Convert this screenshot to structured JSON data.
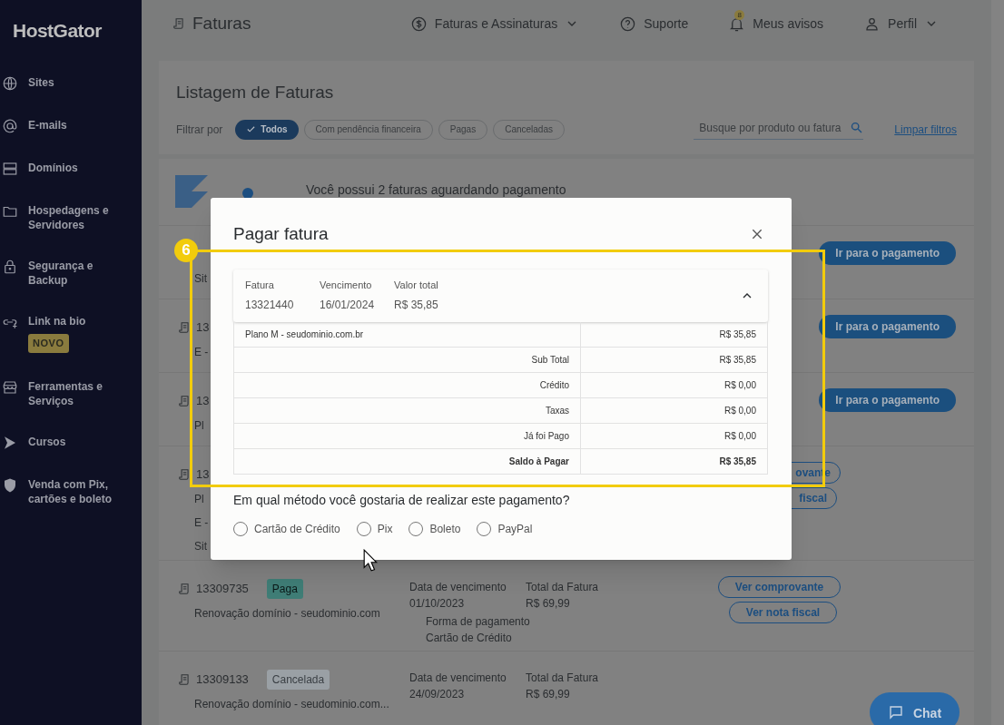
{
  "sidebar": {
    "logo": "HostGator",
    "items": [
      {
        "label": "Sites"
      },
      {
        "label": "E-mails"
      },
      {
        "label": "Domínios"
      },
      {
        "label": "Hospedagens e Servidores"
      },
      {
        "label": "Segurança e Backup"
      },
      {
        "label": "Link na bio",
        "badge": "NOVO"
      },
      {
        "label": "Ferramentas e Serviços"
      },
      {
        "label": "Cursos"
      },
      {
        "label": "Venda com Pix, cartões e boleto"
      }
    ]
  },
  "header": {
    "title": "Faturas",
    "nav": [
      {
        "label": "Faturas e Assinaturas",
        "kind": "dropdown"
      },
      {
        "label": "Suporte",
        "kind": "help"
      },
      {
        "label": "Meus avisos",
        "kind": "notifications",
        "badge": "8"
      },
      {
        "label": "Perfil",
        "kind": "profile"
      }
    ]
  },
  "listing": {
    "title": "Listagem de Faturas",
    "filter_label": "Filtrar por",
    "filters": [
      {
        "label": "Todos",
        "selected": true
      },
      {
        "label": "Com pendência financeira",
        "selected": false
      },
      {
        "label": "Pagas",
        "selected": false
      },
      {
        "label": "Canceladas",
        "selected": false
      }
    ],
    "search": {
      "placeholder": "Busque por produto ou fatura"
    },
    "clear": "Limpar filtros"
  },
  "banner": {
    "text": "Você possui 2 faturas aguardando pagamento"
  },
  "invoices": [
    {
      "lines": [
        "Sit"
      ],
      "actions": [
        {
          "label": "Ir para o pagamento",
          "kind": "pay"
        }
      ]
    },
    {
      "id": "13",
      "lines": [
        "E -"
      ],
      "actions": [
        {
          "label": "Ir para o pagamento",
          "kind": "pay"
        }
      ]
    },
    {
      "id": "13",
      "lines": [
        "Pl"
      ],
      "actions": [
        {
          "label": "Ir para o pagamento",
          "kind": "pay"
        }
      ]
    },
    {
      "id": "13",
      "lines": [
        "Pl",
        "E -",
        "Sit"
      ],
      "actions": [
        {
          "label": "ovante",
          "kind": "outline"
        },
        {
          "label": "fiscal",
          "kind": "outline"
        }
      ]
    },
    {
      "id": "13309735",
      "status": {
        "label": "Paga",
        "kind": "paid"
      },
      "lines": [
        "Renovação domínio - seudominio.com"
      ],
      "due_label": "Data de vencimento",
      "due": "01/10/2023",
      "total_label": "Total da Fatura",
      "total": "R$ 69,99",
      "payment_label": "Forma de pagamento",
      "payment": "Cartão de Crédito",
      "actions": [
        {
          "label": "Ver comprovante",
          "kind": "outline"
        },
        {
          "label": "Ver nota fiscal",
          "kind": "outline"
        }
      ]
    },
    {
      "id": "13309133",
      "status": {
        "label": "Cancelada",
        "kind": "cancelled"
      },
      "lines": [
        "Renovação domínio - seudominio.com..."
      ],
      "due_label": "Data de vencimento",
      "due": "24/09/2023",
      "total_label": "Total da Fatura",
      "total": "R$ 69,99"
    }
  ],
  "chat": "Chat",
  "modal": {
    "title": "Pagar fatura",
    "summary": {
      "expanded": true,
      "fields": [
        {
          "label": "Fatura",
          "value": "13321440"
        },
        {
          "label": "Vencimento",
          "value": "16/01/2024"
        },
        {
          "label": "Valor total",
          "value": "R$ 35,85"
        }
      ]
    },
    "rows": [
      {
        "label": "Plano M - seudominio.com.br",
        "value": "R$ 35,85",
        "kind": "item"
      },
      {
        "label": "Sub Total",
        "value": "R$ 35,85",
        "kind": "sum"
      },
      {
        "label": "Crédito",
        "value": "R$ 0,00",
        "kind": "sum"
      },
      {
        "label": "Taxas",
        "value": "R$ 0,00",
        "kind": "sum"
      },
      {
        "label": "Já foi Pago",
        "value": "R$ 0,00",
        "kind": "sum"
      },
      {
        "label": "Saldo à Pagar",
        "value": "R$ 35,85",
        "kind": "total"
      }
    ],
    "question": "Em qual método você gostaria de realizar este pagamento?",
    "methods": [
      {
        "label": "Cartão de Crédito",
        "selected": false
      },
      {
        "label": "Pix",
        "selected": false
      },
      {
        "label": "Boleto",
        "selected": false
      },
      {
        "label": "PayPal",
        "selected": false
      }
    ]
  },
  "annotation": "6"
}
